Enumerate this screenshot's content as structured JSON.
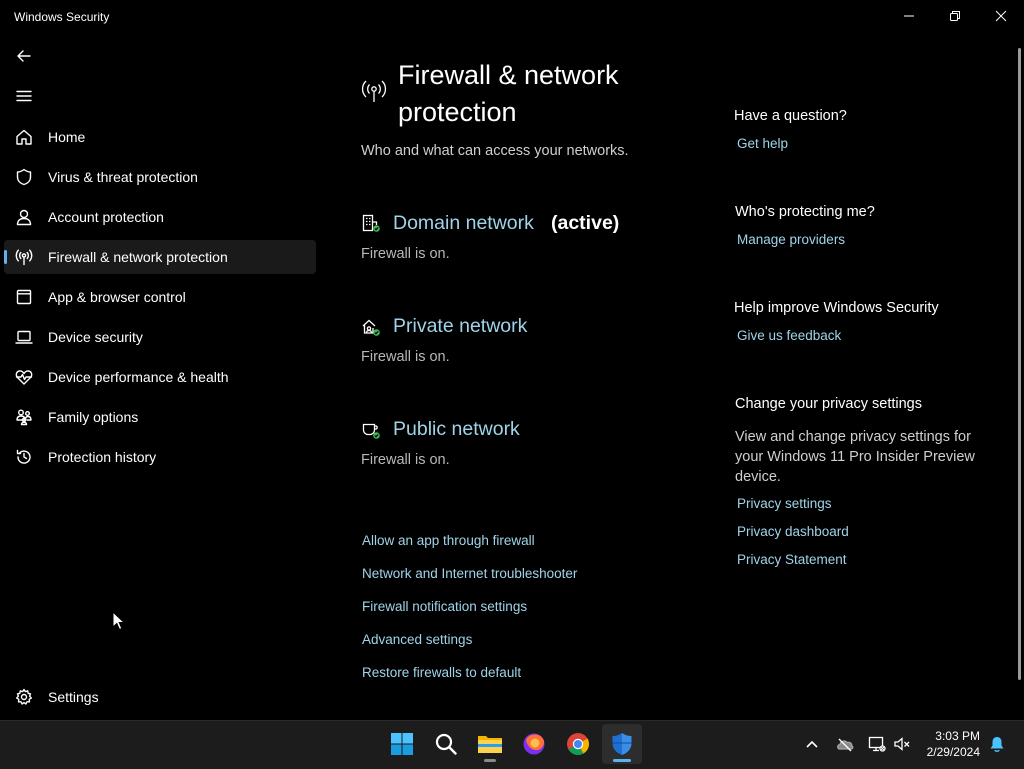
{
  "window": {
    "title": "Windows Security"
  },
  "sidebar": {
    "back_icon": "back-arrow-icon",
    "menu_icon": "hamburger-menu-icon",
    "items": [
      {
        "label": "Home",
        "icon": "home-icon"
      },
      {
        "label": "Virus & threat protection",
        "icon": "shield-icon"
      },
      {
        "label": "Account protection",
        "icon": "person-icon"
      },
      {
        "label": "Firewall & network protection",
        "icon": "antenna-icon",
        "selected": true
      },
      {
        "label": "App & browser control",
        "icon": "browser-window-icon"
      },
      {
        "label": "Device security",
        "icon": "laptop-icon"
      },
      {
        "label": "Device performance & health",
        "icon": "heart-pulse-icon"
      },
      {
        "label": "Family options",
        "icon": "family-icon"
      },
      {
        "label": "Protection history",
        "icon": "history-icon"
      }
    ],
    "settings": {
      "label": "Settings",
      "icon": "gear-icon"
    }
  },
  "main": {
    "title_line1": "Firewall & network",
    "title_line2": "protection",
    "subtitle": "Who and what can access your networks.",
    "networks": [
      {
        "name": "Domain network",
        "active_label": "(active)",
        "status": "Firewall is on.",
        "icon": "domain-network-icon"
      },
      {
        "name": "Private network",
        "active_label": "",
        "status": "Firewall is on.",
        "icon": "private-network-icon"
      },
      {
        "name": "Public network",
        "active_label": "",
        "status": "Firewall is on.",
        "icon": "public-network-icon"
      }
    ],
    "links": [
      "Allow an app through firewall",
      "Network and Internet troubleshooter",
      "Firewall notification settings",
      "Advanced settings",
      "Restore firewalls to default"
    ]
  },
  "right": {
    "question_heading": "Have a question?",
    "get_help": "Get help",
    "protecting_heading": "Who's protecting me?",
    "manage_providers": "Manage providers",
    "improve_heading": "Help improve Windows Security",
    "feedback": "Give us feedback",
    "privacy_heading": "Change your privacy settings",
    "privacy_text": "View and change privacy settings for your Windows 11 Pro Insider Preview device.",
    "privacy_links": [
      "Privacy settings",
      "Privacy dashboard",
      "Privacy Statement"
    ]
  },
  "taskbar": {
    "apps": [
      "windows-start-icon",
      "search-icon",
      "file-explorer-icon",
      "firefox-icon",
      "chrome-icon",
      "windows-security-icon"
    ],
    "tray": [
      "chevron-up-icon",
      "onedrive-cloud-icon",
      "network-icon",
      "volume-muted-icon",
      "notification-bell-icon"
    ],
    "time": "3:03 PM",
    "date": "2/29/2024"
  },
  "colors": {
    "accent": "#5fb2f2",
    "link": "#9fd4e8",
    "status_ok": "#3fb950"
  }
}
